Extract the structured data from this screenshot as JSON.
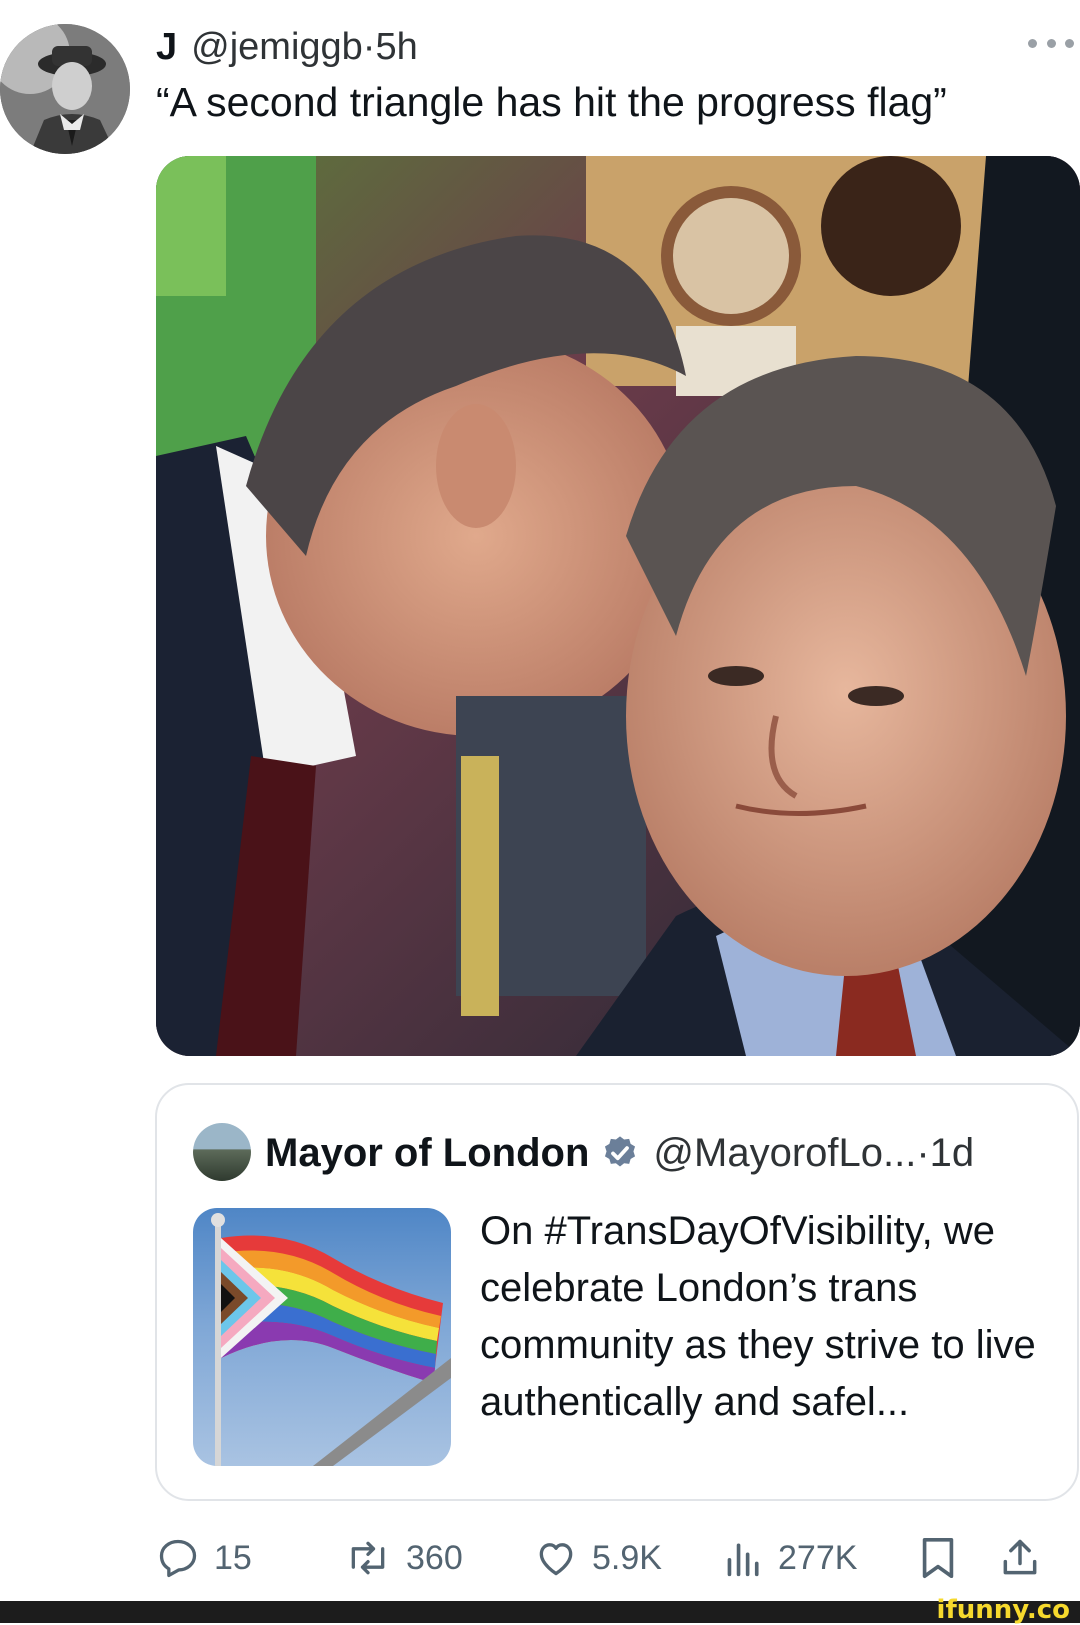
{
  "tweet": {
    "author_name": "J",
    "handle": "@jemiggb",
    "separator": "·",
    "time": "5h",
    "text": "“A second triangle has hit the progress flag”",
    "more_icon": "more-horizontal-icon"
  },
  "quote": {
    "name": "Mayor of London",
    "verified_icon": "verified-badge-icon",
    "verified_color": "#6b7f99",
    "handle": "@MayorofLo...",
    "separator": "·",
    "time": "1d",
    "text": "On #TransDayOfVisibility, we celebrate London’s trans community as they strive to live authentically and safel..."
  },
  "actions": {
    "replies": "15",
    "reposts": "360",
    "likes": "5.9K",
    "views": "277K",
    "icons": [
      "reply-icon",
      "repost-icon",
      "like-icon",
      "views-icon",
      "bookmark-icon",
      "share-icon"
    ]
  },
  "watermark": {
    "text": "ifunny.co",
    "color": "#f6d92d"
  }
}
